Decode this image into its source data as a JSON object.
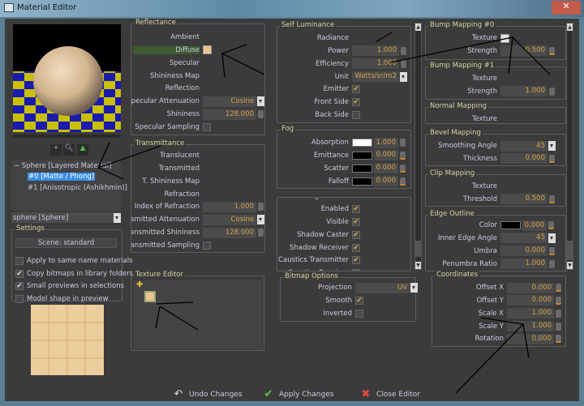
{
  "window": {
    "title": "Material Editor"
  },
  "tree": {
    "root": "Sphere [Layered Material]",
    "items": [
      "#0 [Matte / Phong]",
      "#1 [Anisotropic (Ashikhmin)]"
    ],
    "selected": 0,
    "collapse": "−"
  },
  "shape_select": "sphere [Sphere]",
  "settings": {
    "title": "Settings",
    "scene_button": "Scene: standard",
    "options": [
      {
        "label": "Apply to same name materials",
        "checked": false
      },
      {
        "label": "Copy bitmaps in library folders",
        "checked": true
      },
      {
        "label": "Small previews in selections",
        "checked": true
      },
      {
        "label": "Model shape in preview",
        "checked": false
      }
    ]
  },
  "groups": {
    "reflectance": {
      "title": "Reflectance",
      "rows": [
        {
          "label": "Ambient",
          "type": "none"
        },
        {
          "label": "Diffuse",
          "type": "texture",
          "highlight": true,
          "color": "#e8c490"
        },
        {
          "label": "Specular",
          "type": "none"
        },
        {
          "label": "Shininess Map",
          "type": "none"
        },
        {
          "label": "Reflection",
          "type": "none"
        },
        {
          "label": "Specular Attenuation",
          "type": "dropdown",
          "value": "Cosine"
        },
        {
          "label": "Shininess",
          "type": "field",
          "value": "128.000"
        },
        {
          "label": "Specular Sampling",
          "type": "checkbox",
          "checked": false
        }
      ]
    },
    "transmittance": {
      "title": "Transmittance",
      "rows": [
        {
          "label": "Translucent",
          "type": "none"
        },
        {
          "label": "Transmitted",
          "type": "none"
        },
        {
          "label": "T. Shininess Map",
          "type": "none"
        },
        {
          "label": "Refraction",
          "type": "none"
        },
        {
          "label": "Index of Refraction",
          "type": "field",
          "value": "1.000"
        },
        {
          "label": "Transmitted Attenuation",
          "type": "dropdown",
          "value": "Cosine"
        },
        {
          "label": "Transmitted Shininess",
          "type": "field",
          "value": "128.000"
        },
        {
          "label": "Transmitted Sampling",
          "type": "checkbox",
          "checked": false
        }
      ]
    },
    "self_luminance": {
      "title": "Self Luminance",
      "rows": [
        {
          "label": "Radiance",
          "type": "none"
        },
        {
          "label": "Power",
          "type": "field",
          "value": "1.000"
        },
        {
          "label": "Efficiency",
          "type": "field",
          "value": "1.000"
        },
        {
          "label": "Unit",
          "type": "dropdown",
          "value": "Watts/sr/m2"
        },
        {
          "label": "Emitter",
          "type": "checkbox",
          "checked": true
        },
        {
          "label": "Front Side",
          "type": "checkbox",
          "checked": true
        },
        {
          "label": "Back Side",
          "type": "checkbox",
          "checked": false
        }
      ]
    },
    "fog": {
      "title": "Fog",
      "rows": [
        {
          "label": "Absorption",
          "type": "colorfield",
          "color": "#ffffff",
          "value": "1.000"
        },
        {
          "label": "Emittance",
          "type": "colorfield",
          "color": "#000000",
          "value": "0.000"
        },
        {
          "label": "Scatter",
          "type": "colorfield",
          "color": "#000000",
          "value": "0.000"
        },
        {
          "label": "Falloff",
          "type": "colorfield",
          "color": "#000000",
          "value": "0.000"
        }
      ]
    },
    "model_flags": {
      "title": "Model Flags",
      "rows": [
        {
          "label": "Enabled",
          "type": "checkbox",
          "checked": true
        },
        {
          "label": "Visible",
          "type": "checkbox",
          "checked": true
        },
        {
          "label": "Shadow Caster",
          "type": "checkbox",
          "checked": true
        },
        {
          "label": "Shadow Receiver",
          "type": "checkbox",
          "checked": true
        },
        {
          "label": "Caustics Transmitter",
          "type": "checkbox",
          "checked": true
        },
        {
          "label": "Caustics Receiver",
          "type": "checkbox",
          "checked": true
        }
      ]
    },
    "bitmap_options": {
      "title": "Bitmap Options",
      "rows": [
        {
          "label": "Projection",
          "type": "dropdown",
          "value": "UV"
        },
        {
          "label": "Smooth",
          "type": "checkbox",
          "checked": true
        },
        {
          "label": "Inverted",
          "type": "checkbox",
          "checked": false
        }
      ]
    },
    "bump0": {
      "title": "Bump Mapping #0",
      "rows": [
        {
          "label": "Texture",
          "type": "texture",
          "color": "#e4e4e4"
        },
        {
          "label": "Strength",
          "type": "field",
          "value": "0.500"
        }
      ]
    },
    "bump1": {
      "title": "Bump Mapping #1",
      "rows": [
        {
          "label": "Texture",
          "type": "none"
        },
        {
          "label": "Strength",
          "type": "field",
          "value": "1.000"
        }
      ]
    },
    "normal": {
      "title": "Normal Mapping",
      "rows": [
        {
          "label": "Texture",
          "type": "none"
        }
      ]
    },
    "bevel": {
      "title": "Bevel Mapping",
      "rows": [
        {
          "label": "Smoothing Angle",
          "type": "dropdown",
          "value": "45"
        },
        {
          "label": "Thickness",
          "type": "field",
          "value": "0.000"
        }
      ]
    },
    "clip": {
      "title": "Clip Mapping",
      "rows": [
        {
          "label": "Texture",
          "type": "none"
        },
        {
          "label": "Threshold",
          "type": "field",
          "value": "0.500"
        }
      ]
    },
    "edge": {
      "title": "Edge Outline",
      "rows": [
        {
          "label": "Color",
          "type": "colorfield",
          "color": "#000000",
          "value": "0.000"
        },
        {
          "label": "Inner Edge Angle",
          "type": "dropdown",
          "value": "45"
        },
        {
          "label": "Umbra",
          "type": "field",
          "value": "0.000"
        },
        {
          "label": "Penumbra Ratio",
          "type": "field",
          "value": "1.000"
        }
      ]
    },
    "coordinates": {
      "title": "Coordinates",
      "rows": [
        {
          "label": "Offset X",
          "type": "field",
          "value": "0.000"
        },
        {
          "label": "Offset Y",
          "type": "field",
          "value": "0.000"
        },
        {
          "label": "Scale X",
          "type": "field",
          "value": "1.000"
        },
        {
          "label": "Scale Y",
          "type": "field",
          "value": "1.000"
        },
        {
          "label": "Rotation",
          "type": "field",
          "value": "0.000"
        }
      ]
    }
  },
  "texture_editor": {
    "title": "Texture Editor"
  },
  "buttons": {
    "undo": "Undo Changes",
    "apply": "Apply Changes",
    "close": "Close Editor"
  },
  "colors": {
    "value_text": "#d2a24c",
    "label_text": "#c9cede",
    "group_title": "#d8d4a2",
    "selection": "#3a8ee6"
  }
}
